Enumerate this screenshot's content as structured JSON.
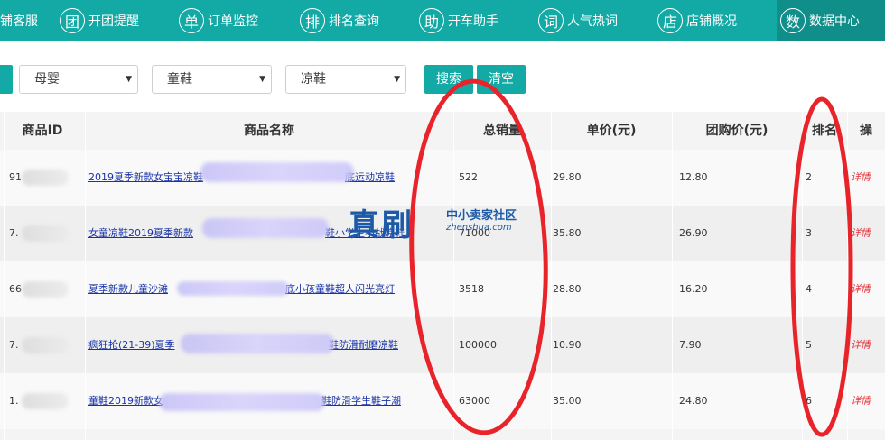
{
  "nav": {
    "items": [
      {
        "icon": "",
        "label": "铺客服",
        "icon_name": "none"
      },
      {
        "icon": "团",
        "label": "开团提醒",
        "icon_name": "group-icon"
      },
      {
        "icon": "单",
        "label": "订单监控",
        "icon_name": "order-icon"
      },
      {
        "icon": "排",
        "label": "排名查询",
        "icon_name": "rank-icon"
      },
      {
        "icon": "助",
        "label": "开车助手",
        "icon_name": "helper-icon"
      },
      {
        "icon": "词",
        "label": "人气热词",
        "icon_name": "keyword-icon"
      },
      {
        "icon": "店",
        "label": "店铺概况",
        "icon_name": "shop-icon"
      },
      {
        "icon": "数",
        "label": "数据中心",
        "icon_name": "data-icon"
      }
    ],
    "active": "数据中心"
  },
  "filters": {
    "category1": "母婴",
    "category2": "童鞋",
    "category3": "凉鞋",
    "search_label": "搜索",
    "clear_label": "清空"
  },
  "table": {
    "headers": [
      "商品ID",
      "商品名称",
      "总销量",
      "单价(元)",
      "团购价(元)",
      "排名",
      "操"
    ],
    "rows": [
      {
        "id": "91",
        "name_left": "2019夏季新款女宝宝凉鞋",
        "name_right": "底运动凉鞋",
        "sales": "522",
        "price": "29.80",
        "group_price": "12.80",
        "rank": "2",
        "action": "详情"
      },
      {
        "id": "7.",
        "name_left": "女童凉鞋2019夏季新款",
        "name_right": "鞋小学生小战凉鞋",
        "sales": "71000",
        "price": "35.80",
        "group_price": "26.90",
        "rank": "3",
        "action": "详情"
      },
      {
        "id": "66",
        "name_left": "夏季新款儿童沙滩",
        "name_right": "底小孩童鞋超人闪光亮灯",
        "sales": "3518",
        "price": "28.80",
        "group_price": "16.20",
        "rank": "4",
        "action": "详情"
      },
      {
        "id": "7.",
        "name_left": "疯狂抢(21-39)夏季",
        "name_right": "鞋防滑耐磨凉鞋",
        "sales": "100000",
        "price": "10.90",
        "group_price": "7.90",
        "rank": "5",
        "action": "详情"
      },
      {
        "id": "1.",
        "name_left": "童鞋2019新款女",
        "name_right": "鞋防滑学生鞋子潮",
        "sales": "63000",
        "price": "35.00",
        "group_price": "24.80",
        "rank": "6",
        "action": "详情"
      }
    ]
  },
  "watermark": {
    "big": "真刷",
    "cn": "中小卖家社区",
    "en": "zhenshua.com"
  },
  "colors": {
    "accent": "#13aaa6",
    "link": "#1a34a8",
    "detail": "#e5323a",
    "annotation": "#e8232a"
  }
}
